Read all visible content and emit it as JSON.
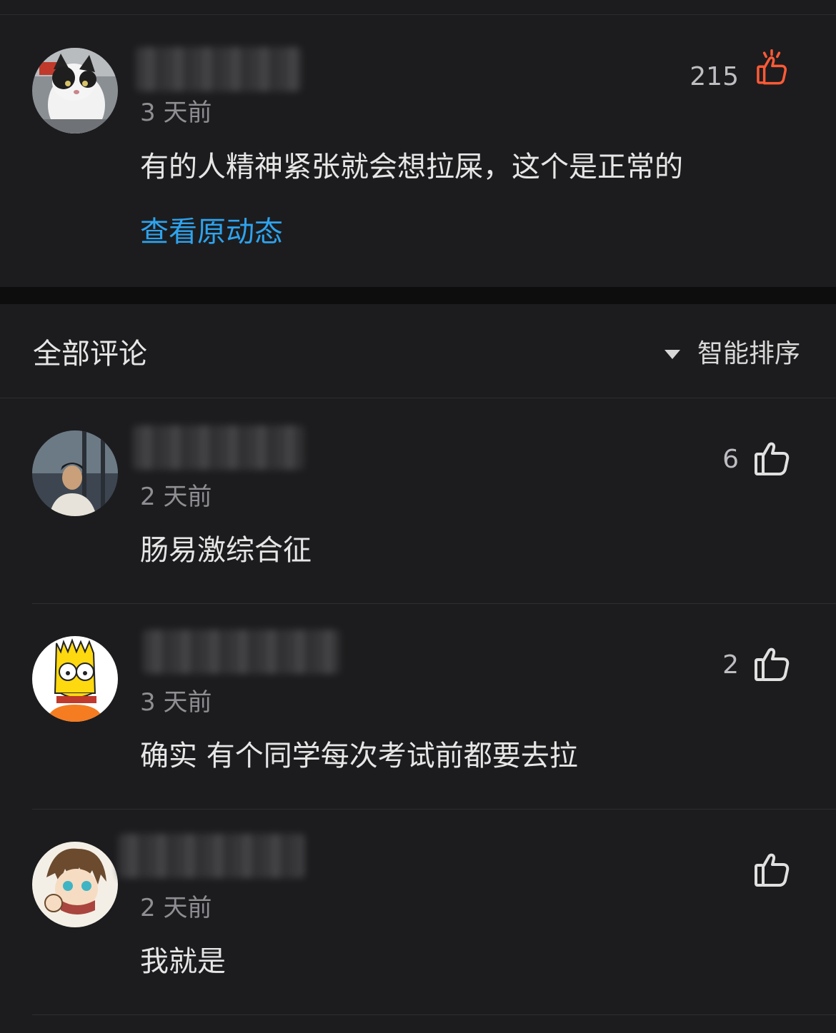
{
  "post": {
    "timestamp": "3 天前",
    "likes": "215",
    "text": "有的人精神紧张就会想拉屎，这个是正常的",
    "view_original": "查看原动态",
    "accent_color": "#ff5a36",
    "link_color": "#2ea3ee",
    "avatar_icon": "cat-avatar",
    "like_icon": "thumbs-up-liked-icon"
  },
  "comments_header": {
    "title": "全部评论",
    "sort_label": "智能排序",
    "sort_icon": "dropdown-triangle-icon"
  },
  "comments": [
    {
      "timestamp": "2 天前",
      "likes": "6",
      "text": "肠易激综合征",
      "avatar_icon": "person-avatar",
      "like_icon": "thumbs-up-icon"
    },
    {
      "timestamp": "3 天前",
      "likes": "2",
      "text": "确实 有个同学每次考试前都要去拉",
      "avatar_icon": "bart-avatar",
      "like_icon": "thumbs-up-icon"
    },
    {
      "timestamp": "2 天前",
      "likes": "",
      "text": "我就是",
      "avatar_icon": "anime-avatar",
      "like_icon": "thumbs-up-icon"
    }
  ]
}
